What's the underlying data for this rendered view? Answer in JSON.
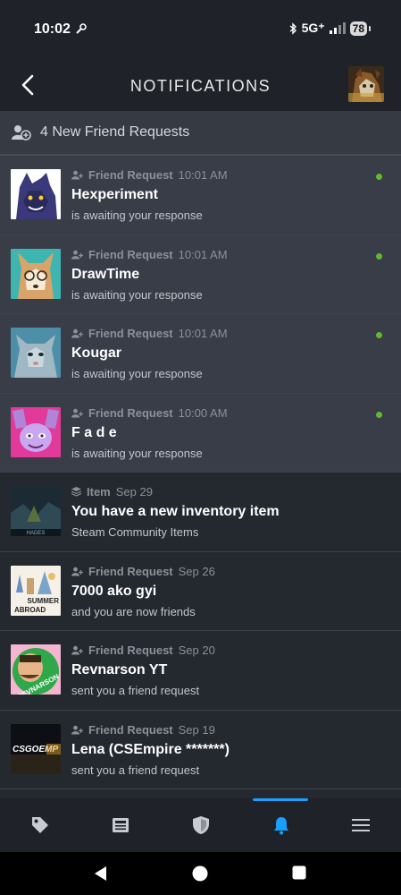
{
  "status": {
    "time": "10:02",
    "network": "5G⁺",
    "battery": "78"
  },
  "header": {
    "title": "NOTIFICATIONS"
  },
  "banner": {
    "text": "4 New Friend Requests"
  },
  "notifications": [
    {
      "type": "Friend Request",
      "time": "10:01 AM",
      "name": "Hexperiment",
      "sub": "is awaiting your response",
      "unread": true
    },
    {
      "type": "Friend Request",
      "time": "10:01 AM",
      "name": "DrawTime",
      "sub": "is awaiting your response",
      "unread": true
    },
    {
      "type": "Friend Request",
      "time": "10:01 AM",
      "name": "Kougar",
      "sub": "is awaiting your response",
      "unread": true
    },
    {
      "type": "Friend Request",
      "time": "10:00 AM",
      "name": "F a d e",
      "sub": "is awaiting your response",
      "unread": true
    },
    {
      "type": "Item",
      "time": "Sep 29",
      "name": "You have a new inventory item",
      "sub": "Steam Community Items",
      "unread": false,
      "avatar_text": "HADES"
    },
    {
      "type": "Friend Request",
      "time": "Sep 26",
      "name": "7000 ako gyi",
      "sub": "and you are now friends",
      "unread": false,
      "avatar_text": [
        "SUMMER",
        "ABROAD"
      ]
    },
    {
      "type": "Friend Request",
      "time": "Sep 20",
      "name": "Revnarson YT",
      "sub": "sent you a friend request",
      "unread": false,
      "avatar_text": "REVNARSON"
    },
    {
      "type": "Friend Request",
      "time": "Sep 19",
      "name": "Lena (CSEmpire *******)",
      "sub": "sent you a friend request",
      "unread": false,
      "avatar_text": "CSGOEMP"
    }
  ],
  "tabs": [
    {
      "icon": "tag-icon",
      "active": false
    },
    {
      "icon": "news-icon",
      "active": false
    },
    {
      "icon": "shield-icon",
      "active": false
    },
    {
      "icon": "bell-icon",
      "active": true
    },
    {
      "icon": "menu-icon",
      "active": false
    }
  ],
  "colors": {
    "accent": "#1a9fff",
    "online": "#5fba2f",
    "background": "#24282f",
    "new_row": "#383d47"
  }
}
